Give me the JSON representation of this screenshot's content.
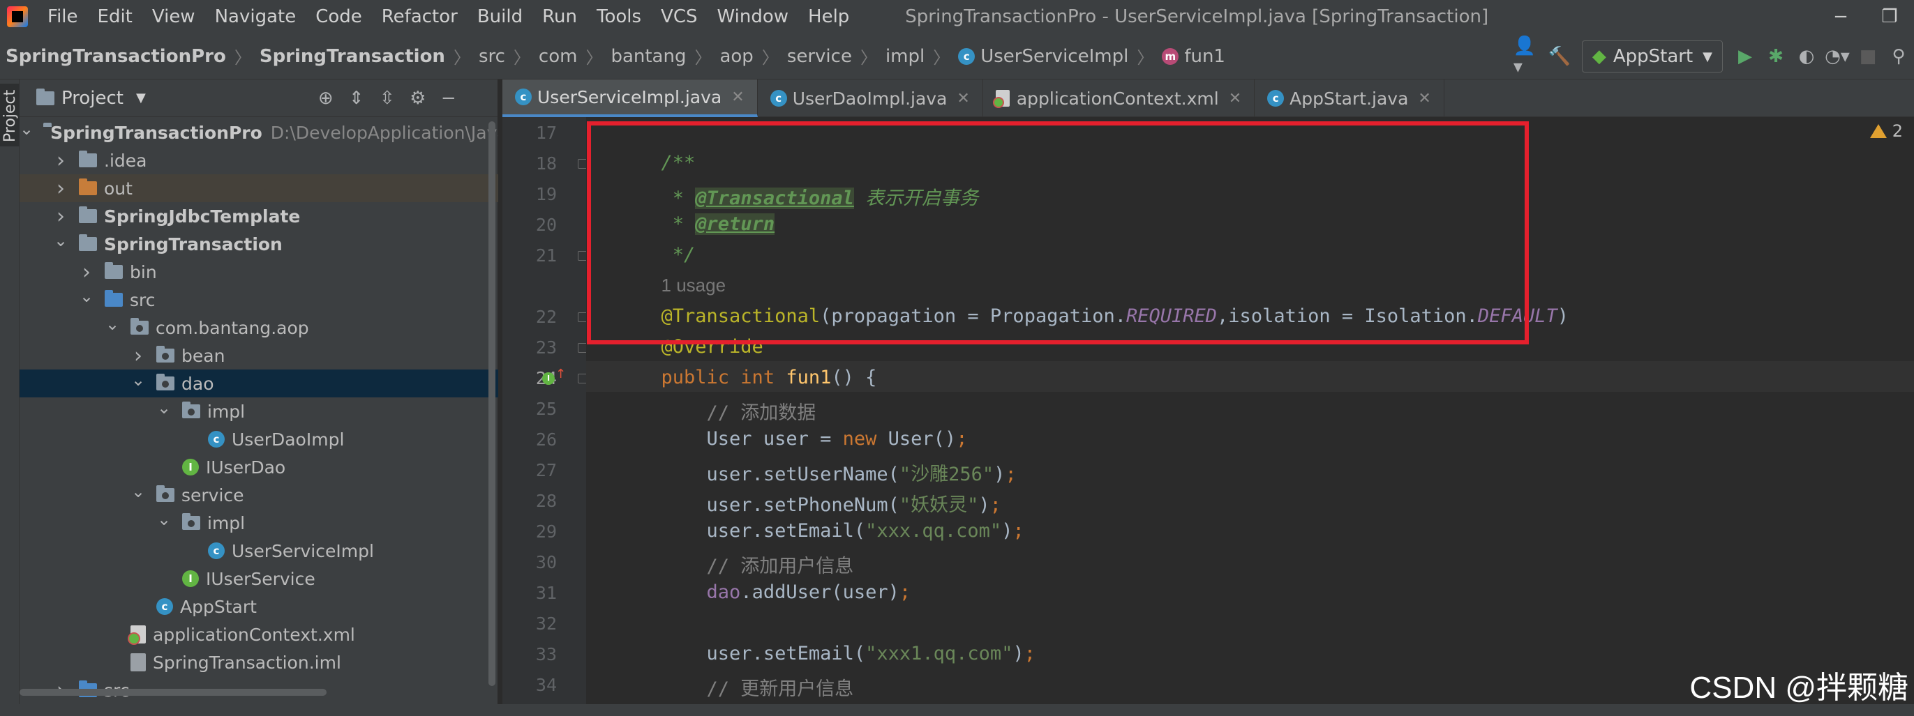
{
  "menubar": {
    "items": [
      "File",
      "Edit",
      "View",
      "Navigate",
      "Code",
      "Refactor",
      "Build",
      "Run",
      "Tools",
      "VCS",
      "Window",
      "Help"
    ],
    "window_title": "SpringTransactionPro - UserServiceImpl.java [SpringTransaction]",
    "minimize": "−",
    "restore": "❐"
  },
  "navbar": {
    "crumbs": [
      "SpringTransactionPro",
      "SpringTransaction",
      "src",
      "com",
      "bantang",
      "aop",
      "service",
      "impl",
      "UserServiceImpl",
      "fun1"
    ],
    "run_config": "AppStart"
  },
  "stripe": {
    "project_label": "Project"
  },
  "project": {
    "title": "Project",
    "tree": [
      {
        "label": "SpringTransactionPro",
        "path": "D:\\DevelopApplication\\JavaW",
        "indent": 0,
        "arrow": "v",
        "icon": "module",
        "bold": true
      },
      {
        "label": ".idea",
        "indent": 1,
        "arrow": ">",
        "icon": "folder"
      },
      {
        "label": "out",
        "indent": 1,
        "arrow": ">",
        "icon": "folder-orange",
        "highlight": true
      },
      {
        "label": "SpringJdbcTemplate",
        "indent": 1,
        "arrow": ">",
        "icon": "module",
        "bold": true
      },
      {
        "label": "SpringTransaction",
        "indent": 1,
        "arrow": "v",
        "icon": "module",
        "bold": true
      },
      {
        "label": "bin",
        "indent": 2,
        "arrow": ">",
        "icon": "folder"
      },
      {
        "label": "src",
        "indent": 2,
        "arrow": "v",
        "icon": "folder-blue"
      },
      {
        "label": "com.bantang.aop",
        "indent": 3,
        "arrow": "v",
        "icon": "package"
      },
      {
        "label": "bean",
        "indent": 4,
        "arrow": ">",
        "icon": "package"
      },
      {
        "label": "dao",
        "indent": 4,
        "arrow": "v",
        "icon": "package",
        "selected": true
      },
      {
        "label": "impl",
        "indent": 5,
        "arrow": "v",
        "icon": "package"
      },
      {
        "label": "UserDaoImpl",
        "indent": 6,
        "arrow": "",
        "icon": "class"
      },
      {
        "label": "IUserDao",
        "indent": 5,
        "arrow": "",
        "icon": "interface"
      },
      {
        "label": "service",
        "indent": 4,
        "arrow": "v",
        "icon": "package"
      },
      {
        "label": "impl",
        "indent": 5,
        "arrow": "v",
        "icon": "package"
      },
      {
        "label": "UserServiceImpl",
        "indent": 6,
        "arrow": "",
        "icon": "class"
      },
      {
        "label": "IUserService",
        "indent": 5,
        "arrow": "",
        "icon": "interface"
      },
      {
        "label": "AppStart",
        "indent": 4,
        "arrow": "",
        "icon": "class"
      },
      {
        "label": "applicationContext.xml",
        "indent": 3,
        "arrow": "",
        "icon": "xml"
      },
      {
        "label": "SpringTransaction.iml",
        "indent": 3,
        "arrow": "",
        "icon": "iml"
      },
      {
        "label": "src",
        "indent": 1,
        "arrow": ">",
        "icon": "folder-blue"
      }
    ]
  },
  "tabs": [
    {
      "label": "UserServiceImpl.java",
      "icon": "class",
      "active": true
    },
    {
      "label": "UserDaoImpl.java",
      "icon": "class",
      "active": false
    },
    {
      "label": "applicationContext.xml",
      "icon": "xml",
      "active": false
    },
    {
      "label": "AppStart.java",
      "icon": "class",
      "active": false
    }
  ],
  "editor": {
    "warning_count": "2",
    "lines": [
      {
        "n": "17",
        "parts": []
      },
      {
        "n": "18",
        "parts": [
          [
            "cm",
            "/**"
          ]
        ]
      },
      {
        "n": "19",
        "parts": [
          [
            "cm",
            " * "
          ],
          [
            "tag",
            "@Transactional"
          ],
          [
            "cm",
            " 表示开启事务"
          ]
        ]
      },
      {
        "n": "20",
        "parts": [
          [
            "cm",
            " * "
          ],
          [
            "tag",
            "@return"
          ]
        ]
      },
      {
        "n": "21",
        "parts": [
          [
            "cm",
            " */"
          ]
        ]
      },
      {
        "n": "",
        "parts": [
          [
            "hint",
            "1 usage"
          ]
        ]
      },
      {
        "n": "22",
        "parts": [
          [
            "ann",
            "@Transactional"
          ],
          [
            "",
            "(propagation = Propagation."
          ],
          [
            "cst",
            "REQUIRED"
          ],
          [
            "",
            ",isolation = Isolation."
          ],
          [
            "cst",
            "DEFAULT"
          ],
          [
            "",
            ")"
          ]
        ]
      },
      {
        "n": "23",
        "parts": [
          [
            "ann",
            "@Override"
          ]
        ]
      },
      {
        "n": "24",
        "parts": [
          [
            "kw",
            "public int "
          ],
          [
            "fn",
            "fun1"
          ],
          [
            "",
            "() {"
          ]
        ]
      },
      {
        "n": "25",
        "parts": [
          [
            "lc",
            "    // 添加数据"
          ]
        ]
      },
      {
        "n": "26",
        "parts": [
          [
            "",
            "    User user = "
          ],
          [
            "kw",
            "new "
          ],
          [
            "",
            "User()"
          ],
          [
            "kw",
            ";"
          ]
        ]
      },
      {
        "n": "27",
        "parts": [
          [
            "",
            "    user.setUserName("
          ],
          [
            "st",
            "\"沙雕256\""
          ],
          [
            "",
            ")"
          ],
          [
            "kw",
            ";"
          ]
        ]
      },
      {
        "n": "28",
        "parts": [
          [
            "",
            "    user.setPhoneNum("
          ],
          [
            "st",
            "\"妖妖灵\""
          ],
          [
            "",
            ")"
          ],
          [
            "kw",
            ";"
          ]
        ]
      },
      {
        "n": "29",
        "parts": [
          [
            "",
            "    user.setEmail("
          ],
          [
            "st",
            "\"xxx.qq.com\""
          ],
          [
            "",
            ")"
          ],
          [
            "kw",
            ";"
          ]
        ]
      },
      {
        "n": "30",
        "parts": [
          [
            "lc",
            "    // 添加用户信息"
          ]
        ]
      },
      {
        "n": "31",
        "parts": [
          [
            "",
            "    "
          ],
          [
            "fld",
            "dao"
          ],
          [
            "",
            ".addUser(user)"
          ],
          [
            "kw",
            ";"
          ]
        ]
      },
      {
        "n": "32",
        "parts": []
      },
      {
        "n": "33",
        "parts": [
          [
            "",
            "    user.setEmail("
          ],
          [
            "st",
            "\"xxx1.qq.com\""
          ],
          [
            "",
            ")"
          ],
          [
            "kw",
            ";"
          ]
        ]
      },
      {
        "n": "34",
        "parts": [
          [
            "lc",
            "    // 更新用户信息"
          ]
        ]
      }
    ],
    "current_line": "24"
  },
  "watermark": "CSDN @拌颗糖"
}
